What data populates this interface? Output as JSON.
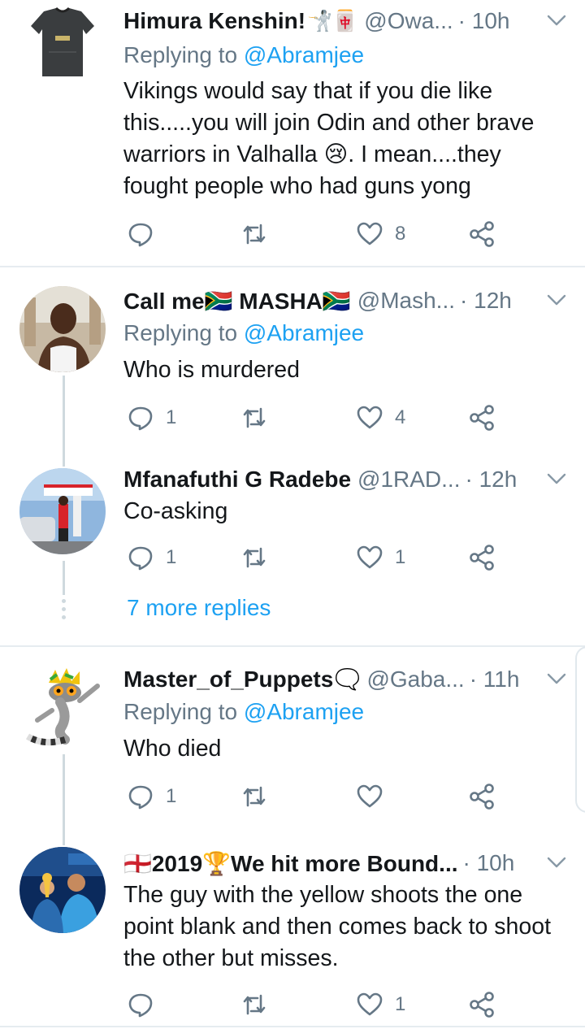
{
  "colors": {
    "accent": "#1da1f2",
    "muted": "#657786",
    "text": "#14171a",
    "divider": "#e6ecf0"
  },
  "tweets": [
    {
      "name": "Himura Kenshin!",
      "emoji": "🤺🀄",
      "handle": "@Owa...",
      "time": "· 10h",
      "replying_prefix": "Replying to ",
      "replying_to": "@Abramjee",
      "text": "Vikings would say that if you die like this.....you will join Odin and other brave warriors in Valhalla 😢. I mean....they fought people who had guns yong",
      "reply_count": "",
      "retweet_count": "",
      "like_count": "8"
    },
    {
      "name": "Call me🇿🇦 MASHA🇿🇦",
      "handle": "@Mash...",
      "time": "· 12h",
      "replying_prefix": "Replying to ",
      "replying_to": "@Abramjee",
      "text": "Who is murdered",
      "reply_count": "1",
      "retweet_count": "",
      "like_count": "4"
    },
    {
      "name": "Mfanafuthi G Radebe",
      "handle": "@1RAD...",
      "time": "· 12h",
      "text": "Co-asking",
      "reply_count": "1",
      "retweet_count": "",
      "like_count": "1"
    },
    {
      "name": "Master_of_Puppets",
      "emoji": "🗨️",
      "handle": "@Gaba...",
      "time": "· 11h",
      "replying_prefix": "Replying to ",
      "replying_to": "@Abramjee",
      "text": "Who died",
      "reply_count": "1",
      "retweet_count": "",
      "like_count": ""
    },
    {
      "name": "🏴󠁧󠁢󠁥󠁮󠁧󠁿2019🏆We hit more Bound...",
      "time": "· 10h",
      "text": "The guy with the yellow shoots the one point blank and then comes back to shoot the other but misses.",
      "reply_count": "",
      "retweet_count": "",
      "like_count": "1"
    }
  ],
  "more_replies": "7 more replies"
}
